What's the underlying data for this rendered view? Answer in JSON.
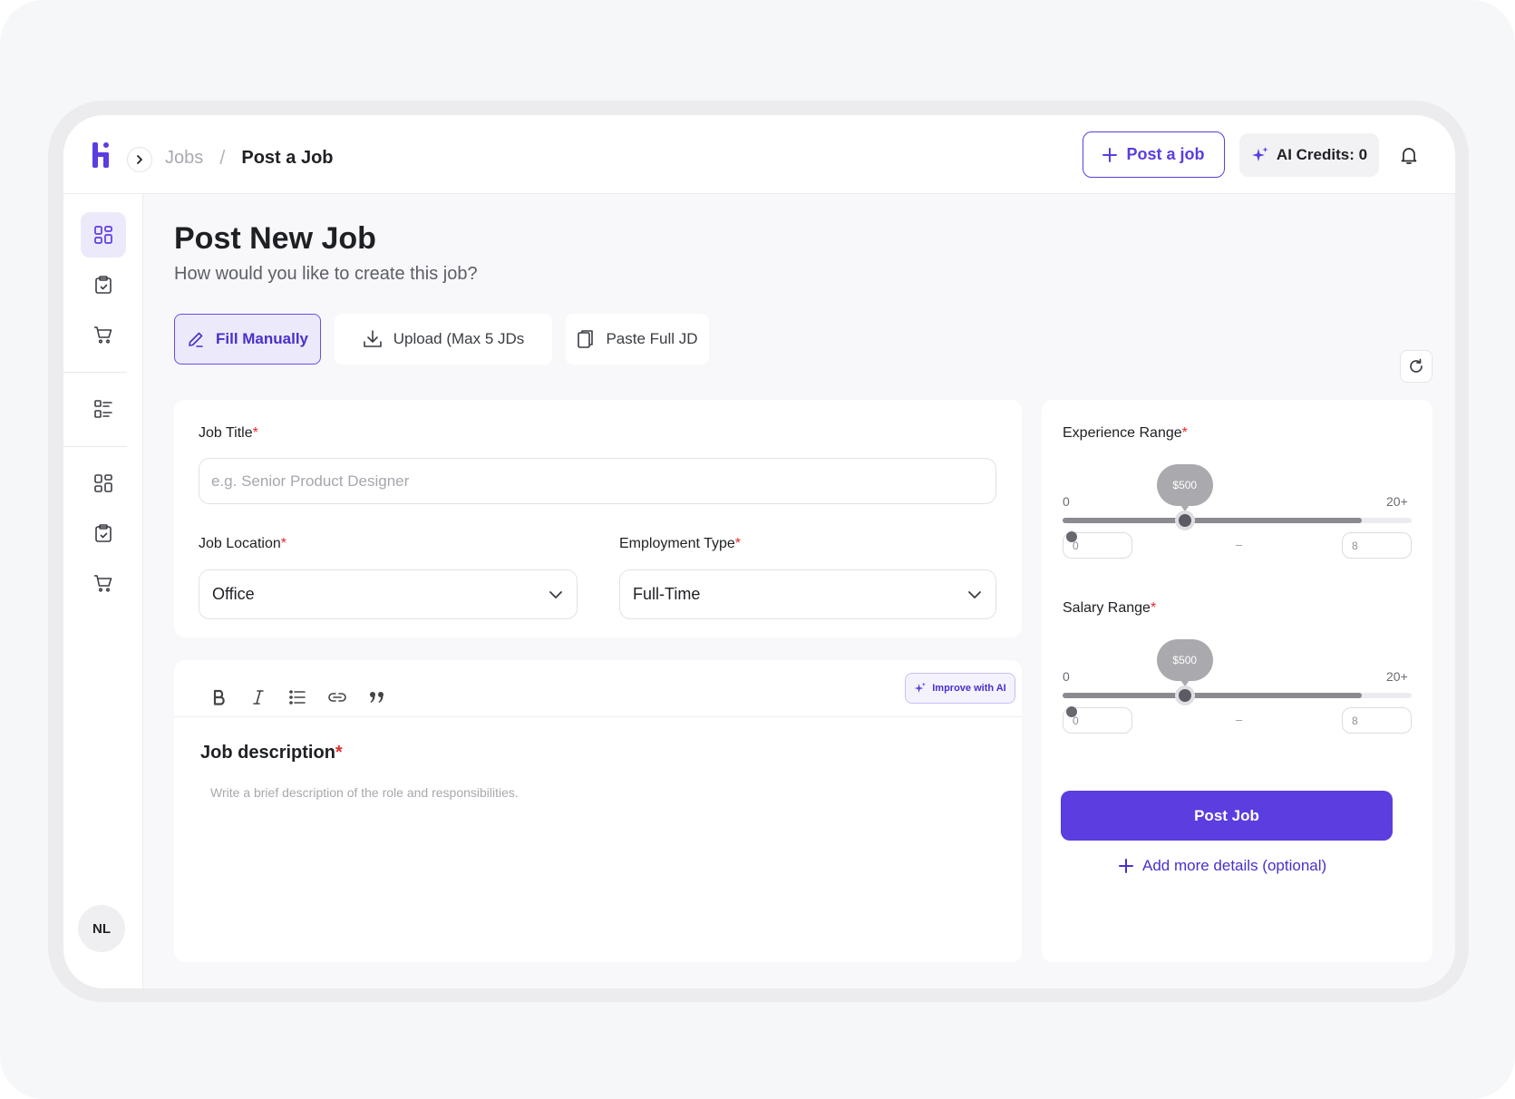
{
  "header": {
    "breadcrumb_parent": "Jobs",
    "breadcrumb_separator": "/",
    "breadcrumb_current": "Post a Job",
    "post_job_label": "Post a job",
    "ai_credits_label": "AI Credits: 0"
  },
  "sidebar": {
    "items": [
      {
        "icon": "dashboard-icon",
        "active": true
      },
      {
        "icon": "clipboard-check-icon",
        "active": false
      },
      {
        "icon": "cart-icon",
        "active": false
      },
      {
        "icon": "list-icon",
        "active": false
      },
      {
        "icon": "dashboard-icon",
        "active": false
      },
      {
        "icon": "clipboard-check-icon",
        "active": false
      },
      {
        "icon": "cart-icon",
        "active": false
      }
    ],
    "avatar_initials": "NL"
  },
  "page": {
    "title": "Post New Job",
    "subtitle": "How would you like to create this job?"
  },
  "modes": {
    "fill_manually": "Fill Manually",
    "upload": "Upload (Max 5 JDs",
    "paste": "Paste Full JD"
  },
  "form": {
    "job_title_label": "Job Title",
    "job_title_placeholder": "e.g. Senior Product Designer",
    "location_label": "Job Location",
    "location_value": "Office",
    "employment_label": "Employment Type",
    "employment_value": "Full-Time",
    "required_mark": "*"
  },
  "editor": {
    "improve_label": "Improve with AI",
    "description_title": "Job description",
    "description_placeholder": "Write a brief description of the role and responsibilities."
  },
  "ranges": {
    "experience": {
      "label": "Experience Range",
      "min_label": "0",
      "max_label": "20+",
      "bubble": "$500",
      "min_value": "0",
      "max_value": "8",
      "thumb_fraction": 0.35
    },
    "salary": {
      "label": "Salary Range",
      "min_label": "0",
      "max_label": "20+",
      "bubble": "$500",
      "min_value": "0",
      "max_value": "8",
      "thumb_fraction": 0.35
    },
    "dash": "–"
  },
  "actions": {
    "post_job": "Post Job",
    "add_more": "Add more details (optional)"
  },
  "colors": {
    "brand": "#5b3de0",
    "brand_light": "#ece9fb",
    "required": "#e02d2d"
  }
}
